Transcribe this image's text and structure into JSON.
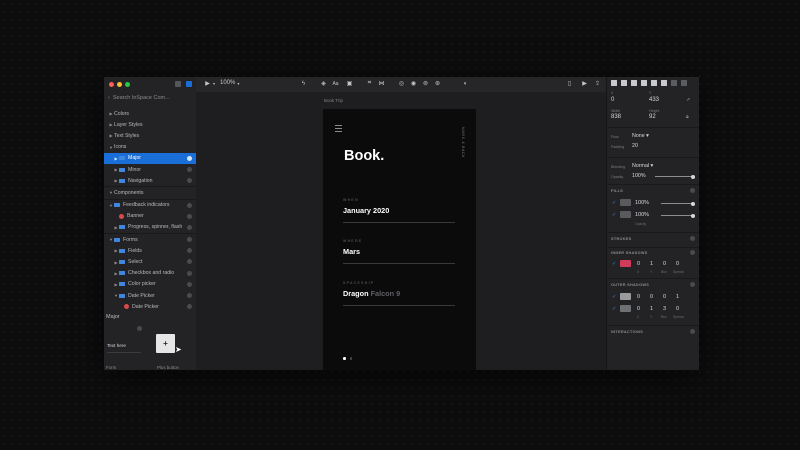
{
  "colors": {
    "accent": "#1a6ed8",
    "close": "#ff5f57",
    "minimize": "#febc2e",
    "maximize": "#28c840",
    "shadow_swatch": "#d23c5a",
    "fill_swatch": "#5a5b5f",
    "symbol": "#d84a4a"
  },
  "left_panel": {
    "search_placeholder": "Search InSpace Com...",
    "tree": [
      {
        "label": "Colors",
        "level": 0,
        "expanded": false
      },
      {
        "label": "Layer Styles",
        "level": 0,
        "expanded": false
      },
      {
        "label": "Text Styles",
        "level": 0,
        "expanded": false
      },
      {
        "label": "Icons",
        "level": 0,
        "expanded": true
      },
      {
        "label": "Major",
        "level": 1,
        "expanded": false,
        "type": "folder",
        "selected": true
      },
      {
        "label": "Minor",
        "level": 1,
        "expanded": false,
        "type": "folder"
      },
      {
        "label": "Navigation",
        "level": 1,
        "expanded": false,
        "type": "folder"
      },
      {
        "label": "Components",
        "level": 0,
        "expanded": true
      },
      {
        "label": "Feedback indicators",
        "level": 0,
        "expanded": true,
        "type": "folder"
      },
      {
        "label": "Banner",
        "level": 1,
        "type": "symbol"
      },
      {
        "label": "Progress, spinner, flash",
        "level": 1,
        "expanded": false,
        "type": "folder"
      },
      {
        "label": "Forms",
        "level": 0,
        "expanded": true,
        "type": "folder"
      },
      {
        "label": "Fields",
        "level": 1,
        "expanded": false,
        "type": "folder"
      },
      {
        "label": "Select",
        "level": 1,
        "expanded": false,
        "type": "folder"
      },
      {
        "label": "Checkbox and radio",
        "level": 1,
        "expanded": false,
        "type": "folder"
      },
      {
        "label": "Color picker",
        "level": 1,
        "expanded": false,
        "type": "folder"
      },
      {
        "label": "Date Picker",
        "level": 1,
        "expanded": true,
        "type": "folder"
      },
      {
        "label": "Date Picker",
        "level": 2,
        "type": "symbol"
      }
    ],
    "preview": {
      "title": "Major",
      "text_sample": "Text here",
      "plus_symbol": "+",
      "label_form": "Form",
      "label_plus": "Plus button"
    }
  },
  "toolbar": {
    "zoom": "100%"
  },
  "canvas": {
    "artboard_name": "Book Trip",
    "title": "Book",
    "title_dot": ".",
    "vertical_text": "MARS & BACK",
    "fields": [
      {
        "label": "WHEN",
        "value": "January 2020",
        "value_soft": ""
      },
      {
        "label": "WHERE",
        "value": "Mars",
        "value_soft": ""
      },
      {
        "label": "SPACESHIP",
        "value": "Dragon",
        "value_soft": "Falcon 9"
      }
    ]
  },
  "inspector": {
    "x_label": "X",
    "x_value": "0",
    "y_label": "Y",
    "y_value": "433",
    "w_label": "Width",
    "w_value": "838",
    "h_label": "Height",
    "h_value": "92",
    "flow_label": "Flow",
    "flow_value": "None",
    "padding_label": "Padding",
    "padding_value": "20",
    "blending_label": "Blending",
    "blending_value": "Normal",
    "opacity_label": "Opacity",
    "opacity_value": "100%",
    "fills_title": "FILLS",
    "fills": [
      {
        "value": "100%"
      },
      {
        "value": "100%"
      }
    ],
    "fills_sub": "Opacity",
    "strokes_title": "STROKES",
    "inner_title": "INNER SHADOWS",
    "inner_values": [
      "0",
      "1",
      "0",
      "0"
    ],
    "outer_title": "OUTER SHADOWS",
    "outer_rows": [
      [
        "0",
        "0",
        "0",
        "1"
      ],
      [
        "0",
        "1",
        "3",
        "0"
      ]
    ],
    "shadow_sub": [
      "X",
      "Y",
      "Blur",
      "Spread"
    ],
    "interactions_title": "INTERACTIONS"
  }
}
